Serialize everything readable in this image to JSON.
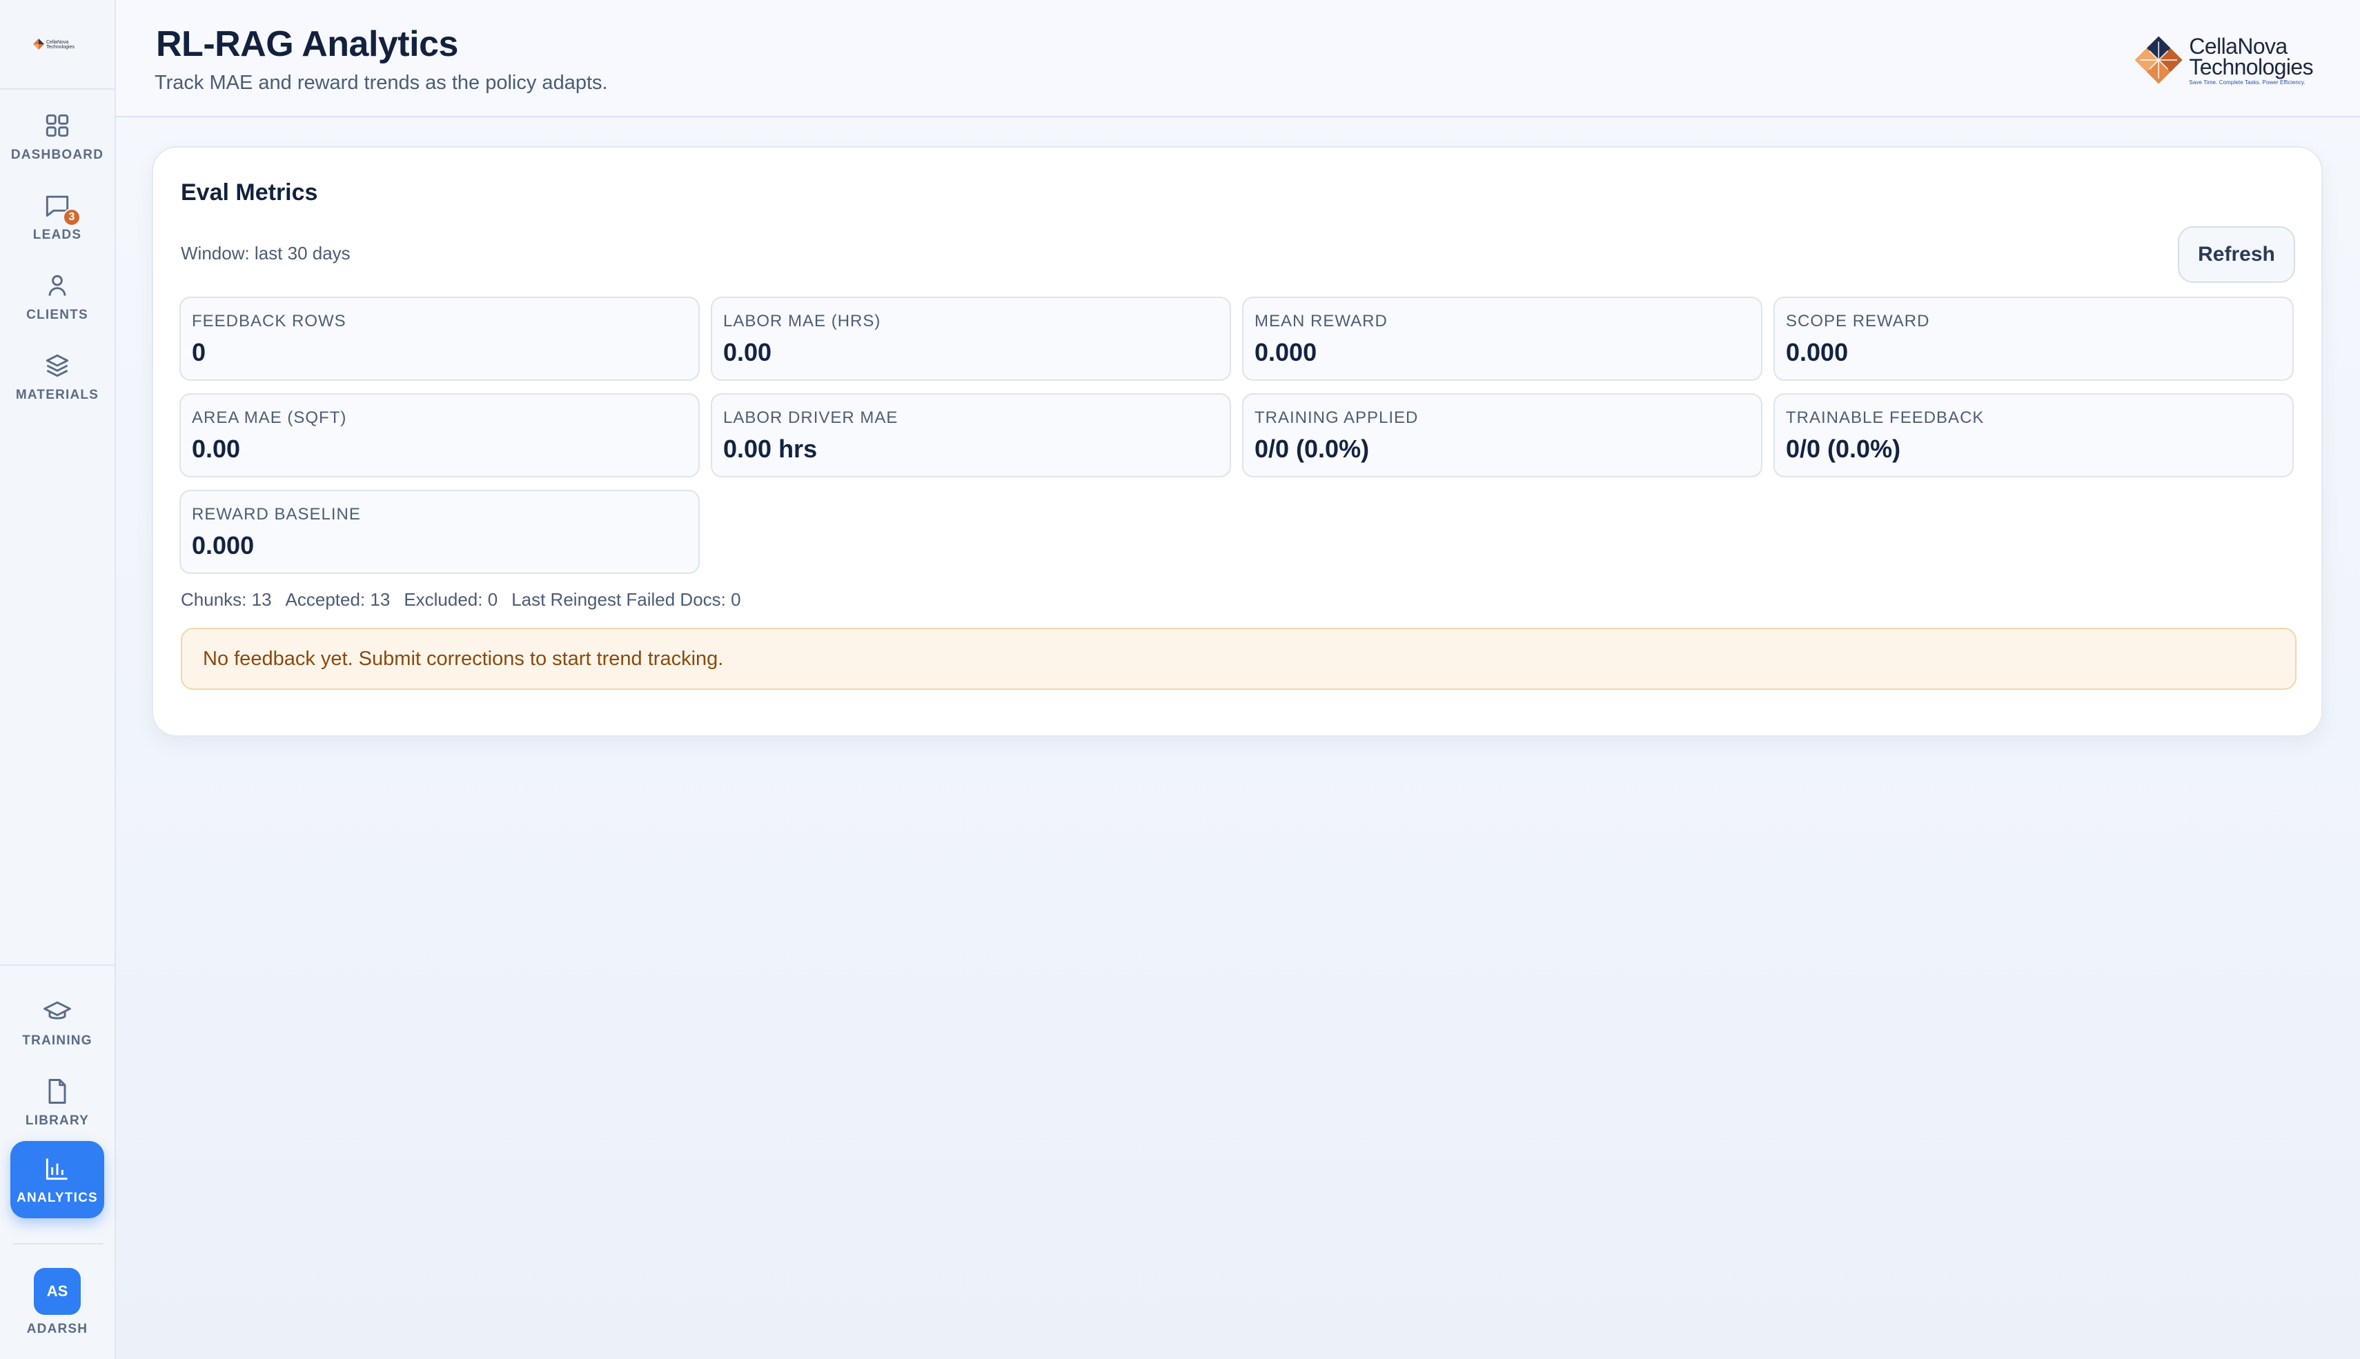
{
  "brand": {
    "name_line1": "CellaNova",
    "name_line2": "Technologies",
    "tagline": "Save Time. Complete Tasks. Power Efficiency."
  },
  "sidebar": {
    "items": [
      {
        "label": "Dashboard",
        "icon": "grid-icon"
      },
      {
        "label": "Leads",
        "icon": "chat-icon",
        "badge": "3"
      },
      {
        "label": "Clients",
        "icon": "user-icon"
      },
      {
        "label": "Materials",
        "icon": "layers-icon"
      }
    ],
    "bottom_items": [
      {
        "label": "Training",
        "icon": "graduation-cap-icon"
      },
      {
        "label": "Library",
        "icon": "document-icon"
      },
      {
        "label": "Analytics",
        "icon": "bar-chart-icon",
        "active": true
      }
    ],
    "user": {
      "initials": "AS",
      "name": "Adarsh"
    }
  },
  "header": {
    "title": "RL-RAG Analytics",
    "subtitle": "Track MAE and reward trends as the policy adapts."
  },
  "card": {
    "title": "Eval Metrics",
    "window": "Window: last 30 days",
    "refresh_label": "Refresh",
    "metrics": [
      {
        "label": "Feedback Rows",
        "value": "0"
      },
      {
        "label": "Labor MAE (hrs)",
        "value": "0.00"
      },
      {
        "label": "Mean Reward",
        "value": "0.000"
      },
      {
        "label": "Scope Reward",
        "value": "0.000"
      },
      {
        "label": "Area MAE (sqft)",
        "value": "0.00"
      },
      {
        "label": "Labor Driver MAE",
        "value": "0.00 hrs"
      },
      {
        "label": "Training Applied",
        "value": "0/0 (0.0%)"
      },
      {
        "label": "Trainable Feedback",
        "value": "0/0 (0.0%)"
      },
      {
        "label": "Reward Baseline",
        "value": "0.000"
      }
    ],
    "stats": {
      "chunks": "Chunks: 13",
      "accepted": "Accepted: 13",
      "excluded": "Excluded: 0",
      "failed_docs": "Last Reingest Failed Docs: 0"
    },
    "notice": "No feedback yet. Submit corrections to start trend tracking."
  },
  "colors": {
    "accent": "#2f7ef4",
    "badge": "#d06a31",
    "notice_bg": "#fdf5ea",
    "notice_text": "#8a4a0c"
  }
}
